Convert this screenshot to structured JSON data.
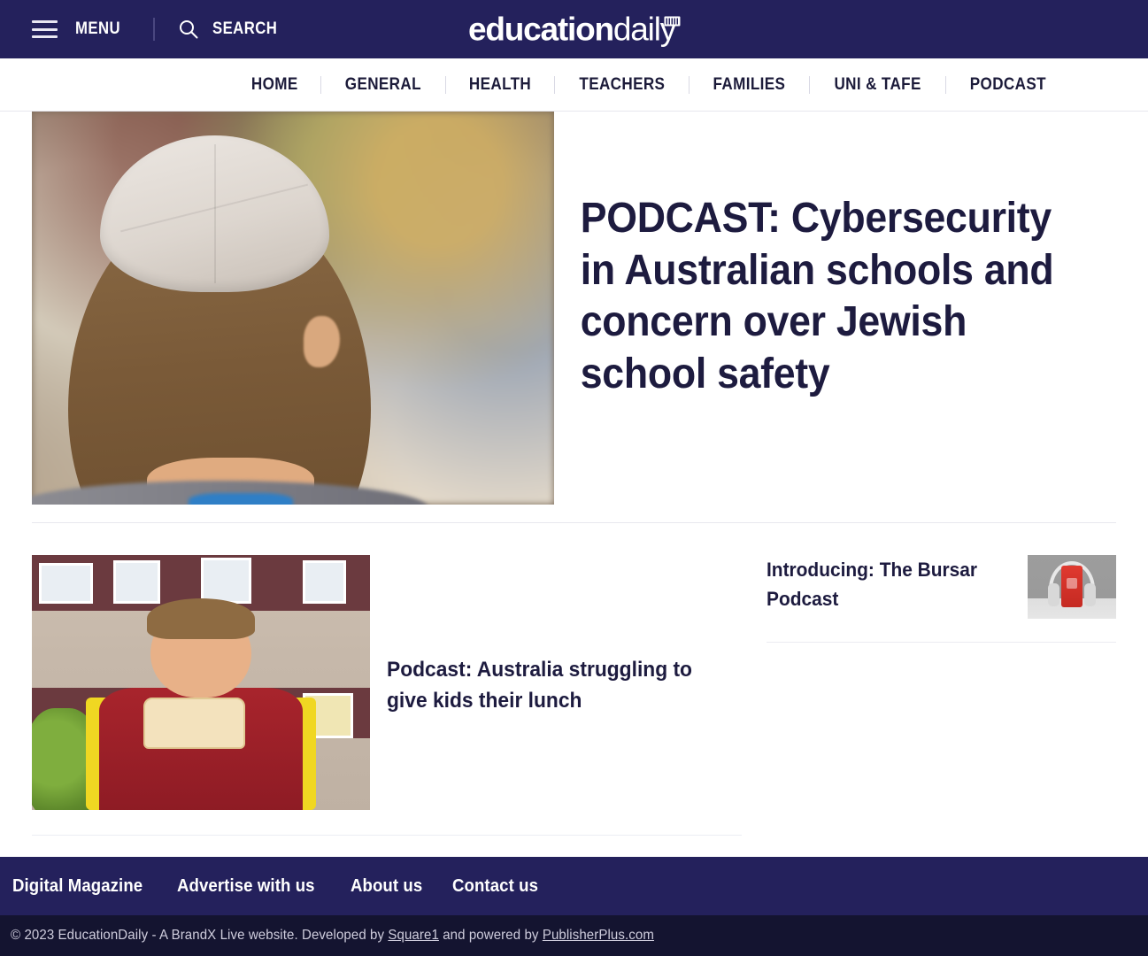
{
  "topbar": {
    "menu_label": "MENU",
    "search_label": "SEARCH",
    "logo_primary": "education",
    "logo_secondary": "daily"
  },
  "nav": {
    "items": [
      {
        "label": "HOME"
      },
      {
        "label": "GENERAL"
      },
      {
        "label": "HEALTH"
      },
      {
        "label": "TEACHERS"
      },
      {
        "label": "FAMILIES"
      },
      {
        "label": "UNI & TAFE"
      },
      {
        "label": "PODCAST"
      }
    ]
  },
  "hero": {
    "title": "PODCAST: Cybersecurity in Australian schools and concern over Jewish school safety",
    "image_alt": "Boy wearing a kippah seen from behind in a classroom"
  },
  "main_articles": [
    {
      "title": "Podcast: Australia struggling to give kids their lunch",
      "image_alt": "Schoolboy in red polo with yellow backpack eating a sandwich"
    }
  ],
  "sidebar": {
    "items": [
      {
        "title": "Introducing: The Bursar Podcast",
        "image_alt": "Red smartphone with white headphones on grey background"
      }
    ]
  },
  "footer": {
    "links": [
      {
        "label": "Digital Magazine"
      },
      {
        "label": "Advertise with us"
      },
      {
        "label": "About us"
      },
      {
        "label": "Contact us"
      }
    ],
    "copyright_prefix": "© 2023 EducationDaily - A BrandX Live website. Developed by ",
    "copyright_link1": "Square1",
    "copyright_mid": " and powered by ",
    "copyright_link2": "PublisherPlus.com"
  },
  "colors": {
    "brand_navy": "#24215c",
    "footer_dark": "#141430",
    "text_dark": "#1d1b3f"
  }
}
